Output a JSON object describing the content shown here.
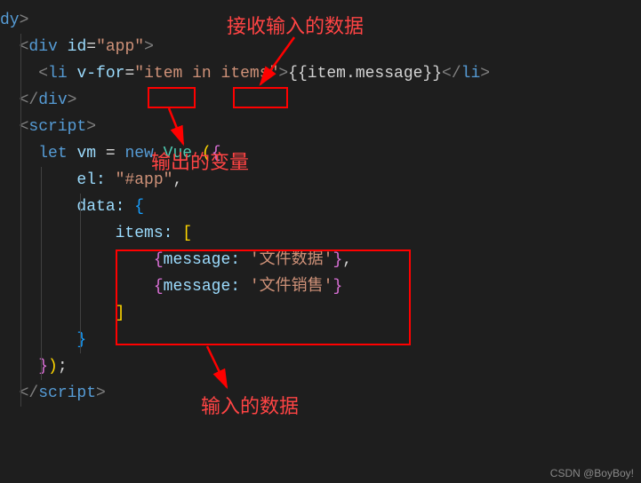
{
  "annotations": {
    "top_label": "接收输入的数据",
    "mid_label": "输出的变量",
    "bottom_label": "输入的数据"
  },
  "code": {
    "l0_close": "dy",
    "l1_open": "div",
    "l1_attr": "id",
    "l1_val": "\"app\"",
    "l2_tag": "li",
    "l2_attr": "v-for",
    "l2_val_q1": "\"",
    "l2_val_item": "item",
    "l2_val_in": " in ",
    "l2_val_items": "items",
    "l2_val_q2": "\"",
    "l2_mustache_open": "{{",
    "l2_item": "item",
    "l2_dot": ".",
    "l2_msg": "message",
    "l2_mustache_close": "}}",
    "l3_div_close": "div",
    "l4_script": "script",
    "l5_let": "let",
    "l5_vm": "vm",
    "l5_eq": " = ",
    "l5_new": "new",
    "l5_vue": "Vue",
    "l6_el": "el:",
    "l6_app": "\"#app\"",
    "l7_data": "data:",
    "l8_items": "items:",
    "l9_msg": "message:",
    "l9_val": "'文件数据'",
    "l10_msg": "message:",
    "l10_val": "'文件销售'",
    "l12_script_close": "script"
  },
  "watermark": "CSDN @BoyBoy!"
}
